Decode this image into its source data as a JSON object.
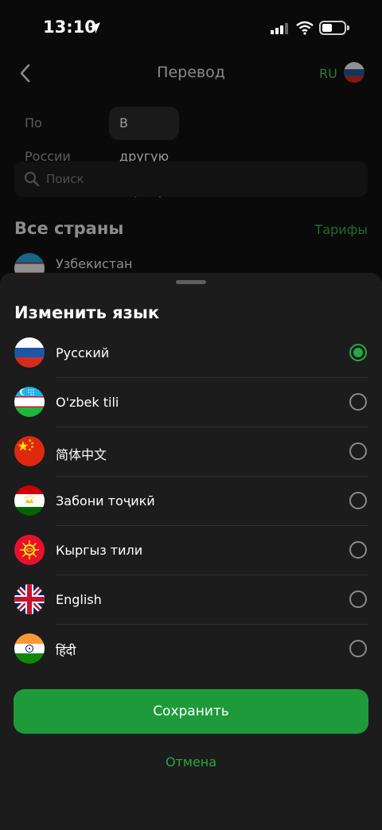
{
  "status_bar": {
    "time": "13:10"
  },
  "header": {
    "title": "Перевод",
    "lang_code": "RU"
  },
  "tabs": [
    {
      "label": "По России",
      "active": false
    },
    {
      "label": "В другую страну",
      "active": true
    }
  ],
  "search": {
    "placeholder": "Поиск"
  },
  "section": {
    "title": "Все страны",
    "link": "Тарифы"
  },
  "countries": [
    {
      "name": "Узбекистан"
    }
  ],
  "sheet": {
    "title": "Изменить язык",
    "languages": [
      {
        "label": "Русский",
        "flag": "russia-flag",
        "selected": true
      },
      {
        "label": "O'zbek tili",
        "flag": "uzbekistan-flag",
        "selected": false
      },
      {
        "label": "简体中文",
        "flag": "china-flag",
        "selected": false
      },
      {
        "label": "Забони тоҷикӣ",
        "flag": "tajikistan-flag",
        "selected": false
      },
      {
        "label": "Кыргыз тили",
        "flag": "kyrgyzstan-flag",
        "selected": false
      },
      {
        "label": "English",
        "flag": "uk-flag",
        "selected": false
      },
      {
        "label": "हिंदी",
        "flag": "india-flag",
        "selected": false
      }
    ],
    "save_label": "Сохранить",
    "cancel_label": "Отмена"
  },
  "colors": {
    "accent": "#1f9a3a",
    "sheet_bg": "#1c1c1c",
    "radio_selected": "#28a745"
  }
}
